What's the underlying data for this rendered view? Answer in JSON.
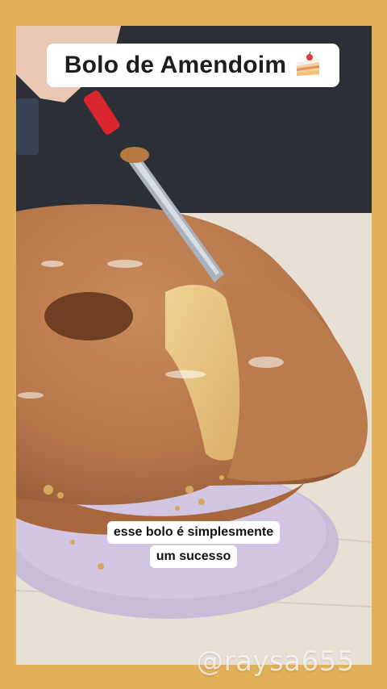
{
  "title": {
    "text": "Bolo de Amendoim",
    "icon": "cake-slice-icon"
  },
  "caption": {
    "line1": "esse bolo é simplesmente",
    "line2": "um sucesso"
  },
  "watermark": "@raysa655",
  "colors": {
    "frame": "#e1b05b",
    "caramel": "#b9784a",
    "cake_crumb": "#e6c17c",
    "plate": "#c9b9d9"
  }
}
